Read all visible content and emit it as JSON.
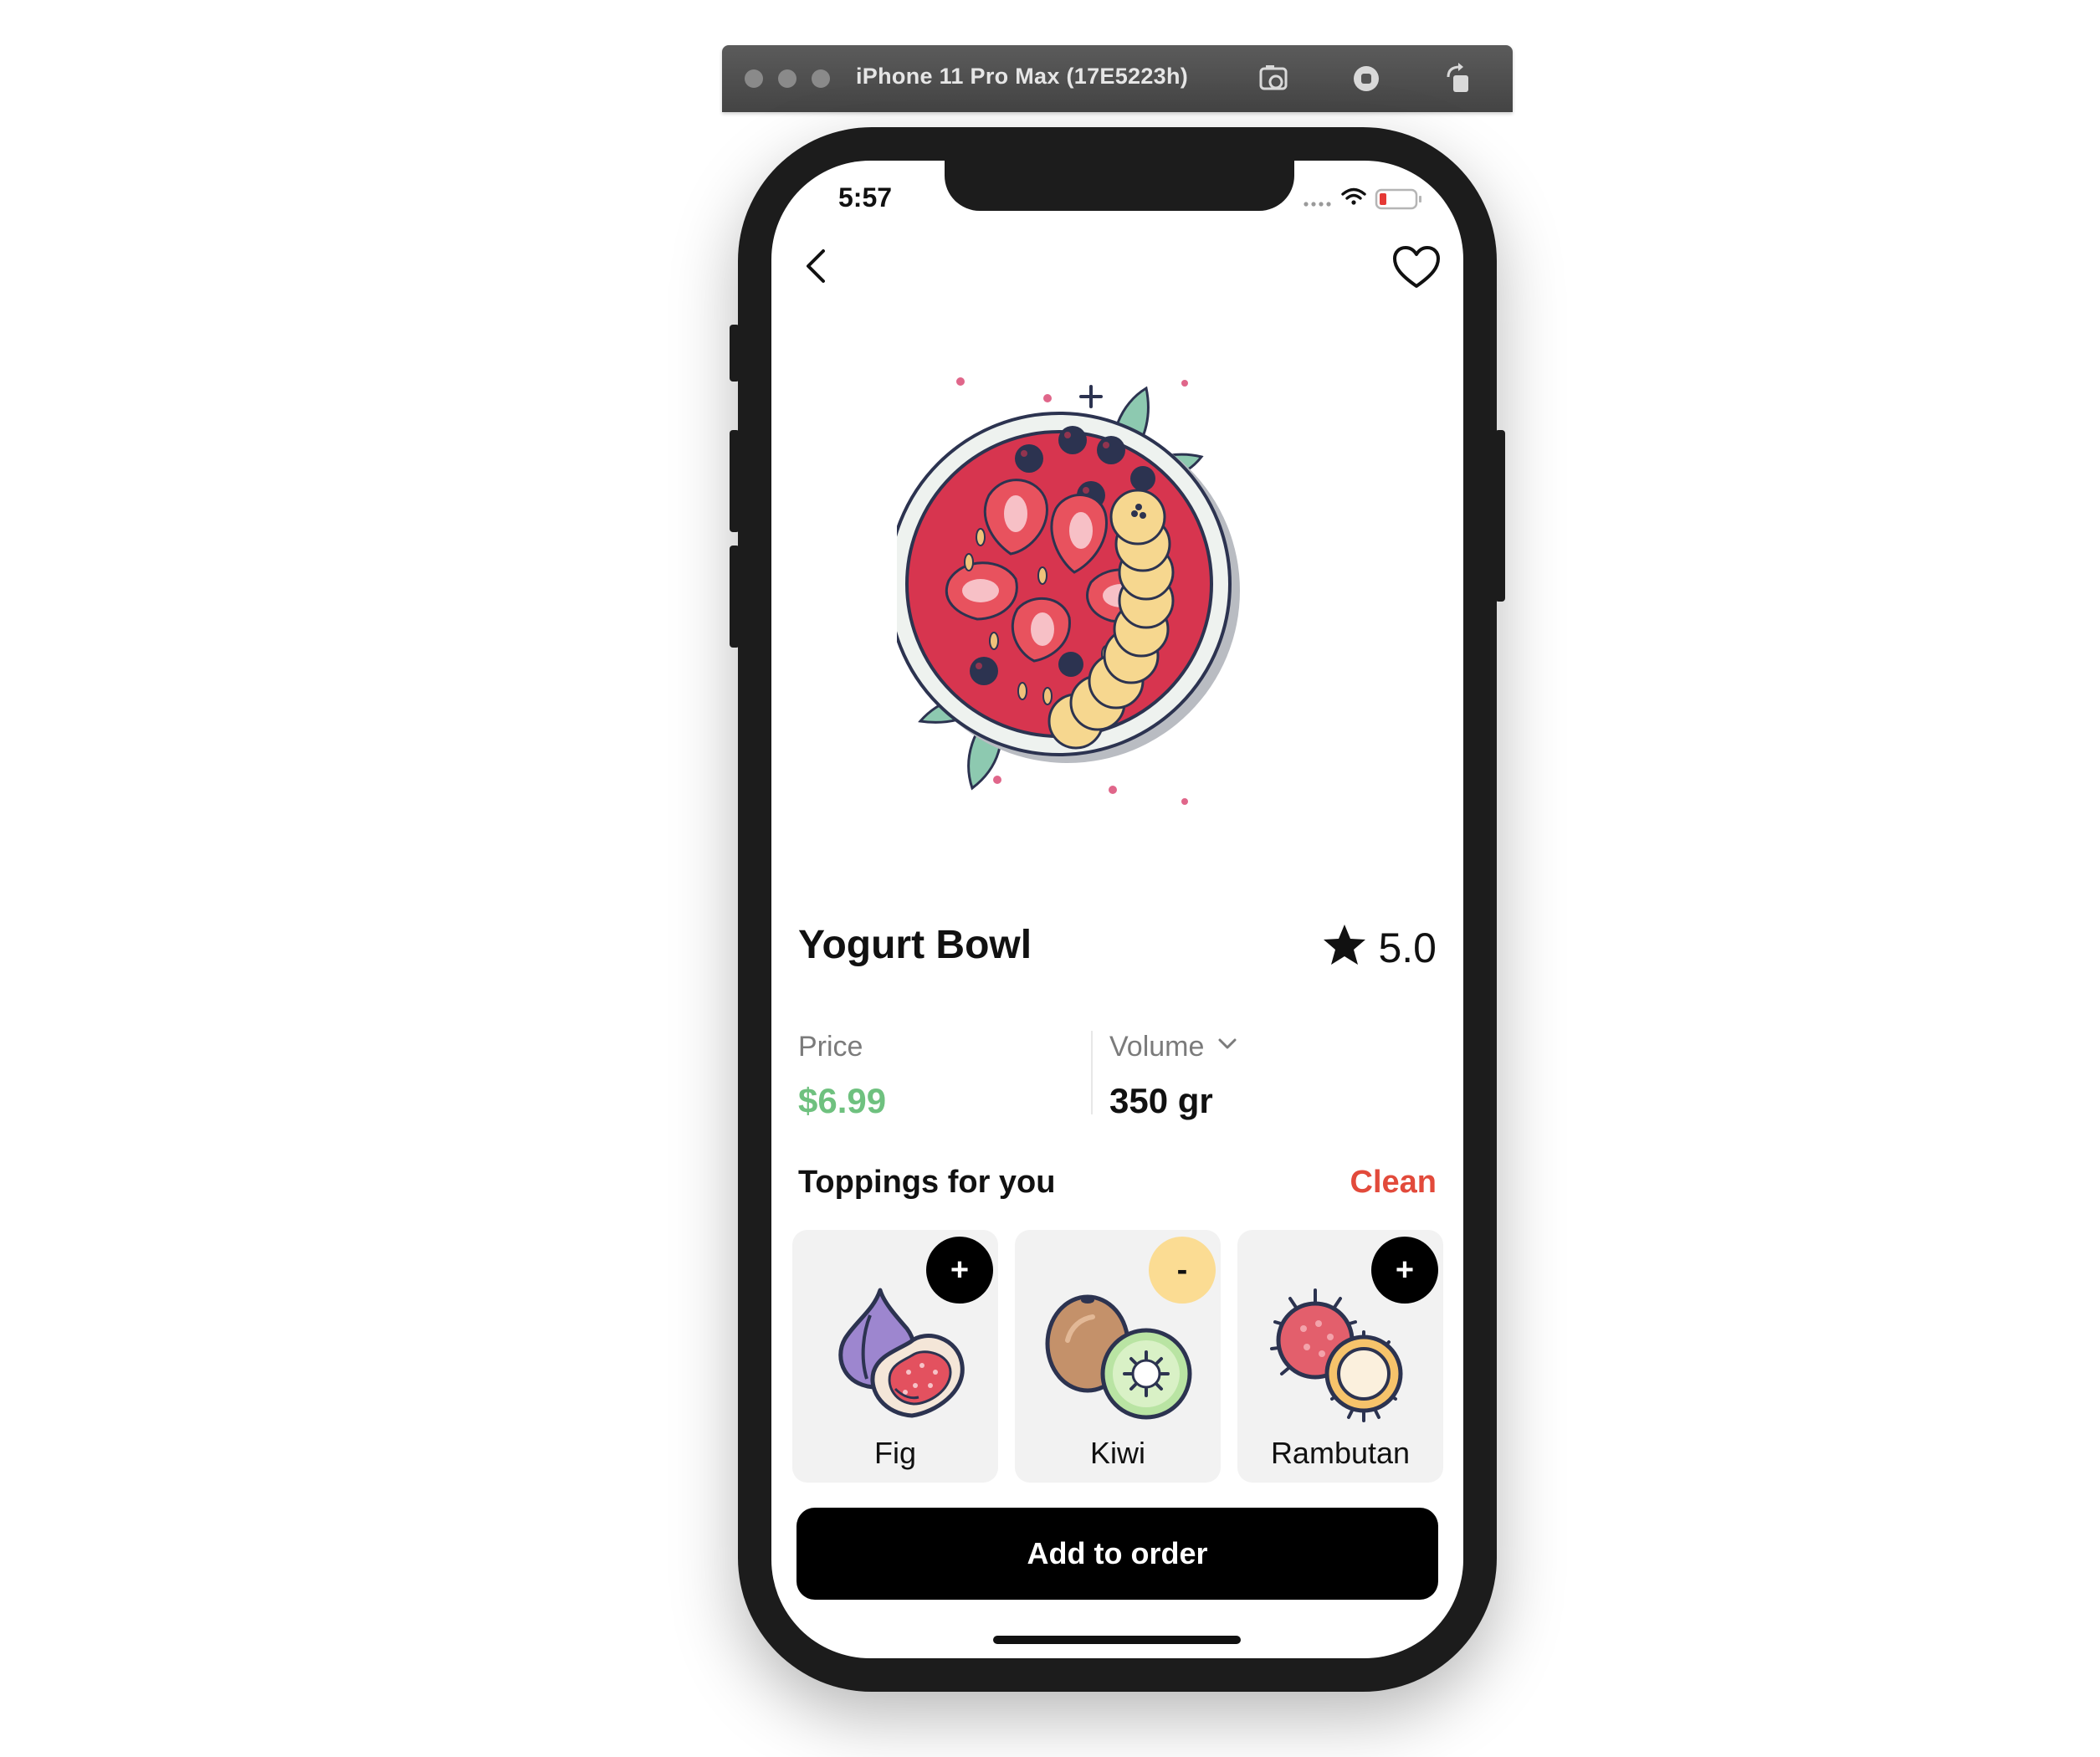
{
  "simulator": {
    "window_title": "iPhone 11 Pro Max (17E5223h)",
    "icons": [
      "screenshot-icon",
      "home-icon",
      "rotate-icon"
    ]
  },
  "status_bar": {
    "time": "5:57",
    "icons": [
      "signal-icon",
      "wifi-icon",
      "battery-icon"
    ]
  },
  "nav": {
    "back_icon": "chevron-left-icon",
    "favorite_icon": "heart-icon"
  },
  "product": {
    "title": "Yogurt Bowl",
    "rating": "5.0",
    "rating_icon": "star-icon",
    "price_label": "Price",
    "price": "$6.99",
    "volume_label": "Volume",
    "volume": "350 gr"
  },
  "toppings": {
    "title": "Toppings for you",
    "clean_label": "Clean",
    "items": [
      {
        "name": "Fig",
        "badge": "+",
        "selected": false
      },
      {
        "name": "Kiwi",
        "badge": "-",
        "selected": true
      },
      {
        "name": "Rambutan",
        "badge": "+",
        "selected": false
      }
    ]
  },
  "cta": {
    "label": "Add to order"
  },
  "colors": {
    "price_green": "#6fc17f",
    "clean_red": "#e24a3b",
    "selected_badge": "#fbdc93",
    "unselected_badge": "#000000",
    "card_background": "#f2f2f2",
    "bowl_red": "#d7354f"
  }
}
